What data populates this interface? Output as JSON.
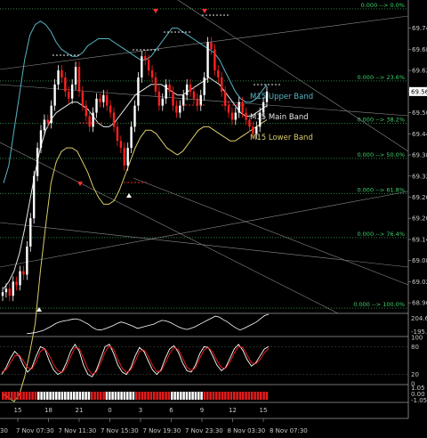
{
  "chart_data": [
    {
      "type": "candlestick",
      "title": "",
      "y_ticks": [
        "69.74",
        "69.68",
        "69.62",
        "69.56",
        "69.50",
        "69.44",
        "69.38",
        "69.32",
        "69.26",
        "69.20",
        "69.14",
        "69.08",
        "69.02",
        "68.96"
      ],
      "current_price": "69.56",
      "ylim": [
        68.93,
        69.82
      ],
      "x_tick_hours": [
        "15",
        "18",
        "21",
        "0",
        "3",
        "6",
        "9",
        "12",
        "15"
      ],
      "x_date_labels": [
        "30",
        "7 Nov 07:30",
        "7 Nov 11:30",
        "7 Nov 15:30",
        "7 Nov 19:30",
        "7 Nov 23:30",
        "8 Nov 03:30",
        "8 Nov 07:30"
      ],
      "fib_levels": [
        {
          "label": "0.000 --> 0.0%",
          "value": 69.795
        },
        {
          "label": "0.000 --> 23.6%",
          "value": 69.59
        },
        {
          "label": "0.000 --> 38.2%",
          "value": 69.47
        },
        {
          "label": "0.000 --> 50.0%",
          "value": 69.37
        },
        {
          "label": "0.000 --> 61.8%",
          "value": 69.27
        },
        {
          "label": "0.000 --> 76.4%",
          "value": 69.145
        },
        {
          "label": "0.000 --> 100.0%",
          "value": 68.945
        }
      ],
      "band_labels": {
        "upper": "M15 Upper Band",
        "main": "M15 Main Band",
        "lower": "M15 Lower Band"
      },
      "closes": [
        68.99,
        69.0,
        68.98,
        69.02,
        69.01,
        69.05,
        69.04,
        69.12,
        69.2,
        69.32,
        69.4,
        69.45,
        69.48,
        69.47,
        69.52,
        69.58,
        69.62,
        69.6,
        69.56,
        69.54,
        69.58,
        69.63,
        69.56,
        69.52,
        69.49,
        69.46,
        69.5,
        69.54,
        69.53,
        69.55,
        69.52,
        69.5,
        69.46,
        69.42,
        69.4,
        69.35,
        69.4,
        69.46,
        69.52,
        69.6,
        69.66,
        69.65,
        69.62,
        69.6,
        69.56,
        69.52,
        69.54,
        69.58,
        69.56,
        69.52,
        69.5,
        69.52,
        69.55,
        69.58,
        69.56,
        69.54,
        69.52,
        69.55,
        69.6,
        69.7,
        69.68,
        69.62,
        69.6,
        69.56,
        69.52,
        69.5,
        69.48,
        69.5,
        69.53,
        69.5,
        69.48,
        69.46,
        69.44,
        69.46,
        69.5,
        69.53,
        69.56
      ],
      "upper_band": [
        69.3,
        69.35,
        69.45,
        69.55,
        69.65,
        69.72,
        69.75,
        69.76,
        69.75,
        69.73,
        69.7,
        69.68,
        69.67,
        69.66,
        69.66,
        69.67,
        69.69,
        69.7,
        69.71,
        69.71,
        69.71,
        69.7,
        69.69,
        69.68,
        69.67,
        69.66,
        69.65,
        69.65,
        69.66,
        69.68,
        69.7,
        69.72,
        69.74,
        69.74,
        69.73,
        69.72,
        69.71,
        69.7,
        69.69,
        69.68,
        69.67,
        69.65,
        69.62,
        69.59,
        69.56,
        69.54,
        69.53,
        69.53,
        69.54,
        69.56,
        69.58
      ],
      "main_band": [
        69.0,
        69.02,
        69.05,
        69.1,
        69.17,
        69.25,
        69.33,
        69.4,
        69.45,
        69.48,
        69.5,
        69.51,
        69.52,
        69.53,
        69.53,
        69.52,
        69.51,
        69.49,
        69.47,
        69.46,
        69.46,
        69.47,
        69.49,
        69.51,
        69.53,
        69.55,
        69.56,
        69.57,
        69.58,
        69.58,
        69.58,
        69.57,
        69.56,
        69.55,
        69.55,
        69.56,
        69.57,
        69.58,
        69.59,
        69.6,
        69.59,
        69.58,
        69.56,
        69.54,
        69.52,
        69.5,
        69.49,
        69.49,
        69.5,
        69.51,
        69.52
      ],
      "lower_band": [
        68.7,
        68.69,
        68.68,
        68.7,
        68.75,
        68.82,
        68.9,
        69.05,
        69.18,
        69.3,
        69.36,
        69.39,
        69.4,
        69.4,
        69.39,
        69.36,
        69.33,
        69.29,
        69.26,
        69.24,
        69.24,
        69.25,
        69.28,
        69.32,
        69.36,
        69.4,
        69.43,
        69.45,
        69.45,
        69.44,
        69.42,
        69.4,
        69.39,
        69.38,
        69.39,
        69.41,
        69.43,
        69.45,
        69.46,
        69.46,
        69.45,
        69.44,
        69.43,
        69.42,
        69.42,
        69.43,
        69.44,
        69.45,
        69.46,
        69.47,
        69.48
      ]
    },
    {
      "type": "line",
      "title": "",
      "y_ticks": [
        "204.6",
        "-195.5"
      ],
      "values": [
        -160,
        -150,
        -140,
        -120,
        -100,
        -60,
        -20,
        30,
        60,
        80,
        90,
        110,
        120,
        100,
        60,
        20,
        -40,
        -80,
        -90,
        -70,
        -40,
        -10,
        30,
        60,
        40,
        10,
        -20,
        -60,
        -40,
        -20,
        0,
        20,
        60,
        90,
        80,
        50,
        10,
        -30,
        -60,
        -80,
        -60,
        -30,
        10,
        50,
        90,
        130,
        170,
        150,
        100,
        60,
        0,
        -50,
        -90,
        -60,
        -20,
        20,
        60,
        120,
        180,
        204
      ]
    },
    {
      "type": "line",
      "title": "",
      "y_ticks": [
        "100",
        "80",
        "20",
        "0"
      ],
      "series": [
        {
          "values": [
            20,
            35,
            55,
            70,
            60,
            40,
            25,
            35,
            60,
            80,
            75,
            50,
            30,
            20,
            25,
            45,
            70,
            85,
            70,
            40,
            20,
            15,
            30,
            55,
            80,
            85,
            65,
            40,
            25,
            20,
            35,
            60,
            78,
            70,
            50,
            30,
            20,
            30,
            55,
            75,
            82,
            68,
            45,
            28,
            25,
            40,
            65,
            80,
            78,
            60,
            40,
            28,
            35,
            55,
            75,
            85,
            72,
            52,
            38,
            45,
            60,
            75,
            80
          ]
        },
        {
          "values": [
            25,
            30,
            45,
            60,
            62,
            50,
            35,
            32,
            48,
            70,
            76,
            62,
            42,
            28,
            24,
            36,
            58,
            78,
            76,
            55,
            32,
            20,
            26,
            45,
            68,
            82,
            74,
            52,
            33,
            24,
            30,
            48,
            70,
            73,
            60,
            40,
            26,
            27,
            45,
            65,
            78,
            74,
            56,
            36,
            28,
            34,
            55,
            73,
            78,
            68,
            50,
            35,
            33,
            47,
            66,
            80,
            78,
            62,
            45,
            43,
            52,
            67,
            76
          ]
        }
      ]
    },
    {
      "type": "bar",
      "title": "",
      "y_ticks": [
        "1.05",
        "0.00",
        "-1.05"
      ],
      "values": [
        1,
        1,
        1,
        1,
        1,
        1,
        1,
        1,
        1,
        1,
        1,
        1,
        0,
        0,
        0,
        0,
        0,
        0,
        0,
        0,
        0,
        0,
        0,
        0,
        0,
        0,
        0,
        0,
        0,
        0,
        1,
        1,
        1,
        1,
        1,
        0,
        0,
        0,
        0,
        0,
        0,
        0,
        0,
        0,
        0,
        1,
        1,
        1,
        1,
        1,
        1,
        1,
        1,
        1,
        1,
        1,
        1,
        0,
        0,
        0,
        0,
        0,
        0,
        0,
        0,
        0,
        0,
        0,
        1,
        1,
        1,
        1,
        1,
        1,
        1,
        1,
        1,
        1,
        1,
        1,
        1,
        1,
        1,
        1,
        1,
        1,
        1,
        1,
        1,
        1
      ]
    }
  ],
  "colors": {
    "bull": "#ffffff",
    "bear": "#ff2020",
    "upper": "#58b4c4",
    "main": "#e6e6e6",
    "lower": "#d9cc6a",
    "fib": "#3fd26a",
    "stoch_k": "#ffffff",
    "stoch_d": "#ff2020",
    "cci": "#ffffff",
    "bar_on": "#e11c1c",
    "bar_off": "#ffffff"
  }
}
